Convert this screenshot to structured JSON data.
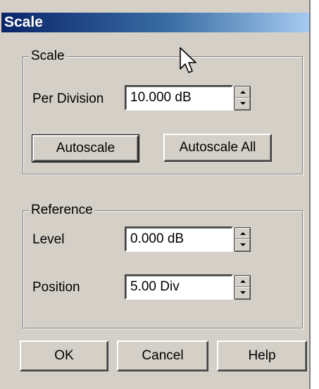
{
  "window": {
    "title": "Scale"
  },
  "scale_group": {
    "label": "Scale",
    "per_division": {
      "label": "Per Division",
      "value": "10.000 dB"
    },
    "autoscale_label": "Autoscale",
    "autoscale_all_label": "Autoscale All"
  },
  "reference_group": {
    "label": "Reference",
    "level": {
      "label": "Level",
      "value": "0.000 dB"
    },
    "position": {
      "label": "Position",
      "value": "5.00 Div"
    }
  },
  "buttons": {
    "ok": "OK",
    "cancel": "Cancel",
    "help": "Help"
  },
  "icons": {
    "cursor": "mouse-pointer-icon",
    "spin_up": "arrow-up-icon",
    "spin_down": "arrow-down-icon"
  },
  "colors": {
    "title_start": "#0a246a",
    "title_end": "#a6caf0",
    "face": "#d4d0c8"
  }
}
